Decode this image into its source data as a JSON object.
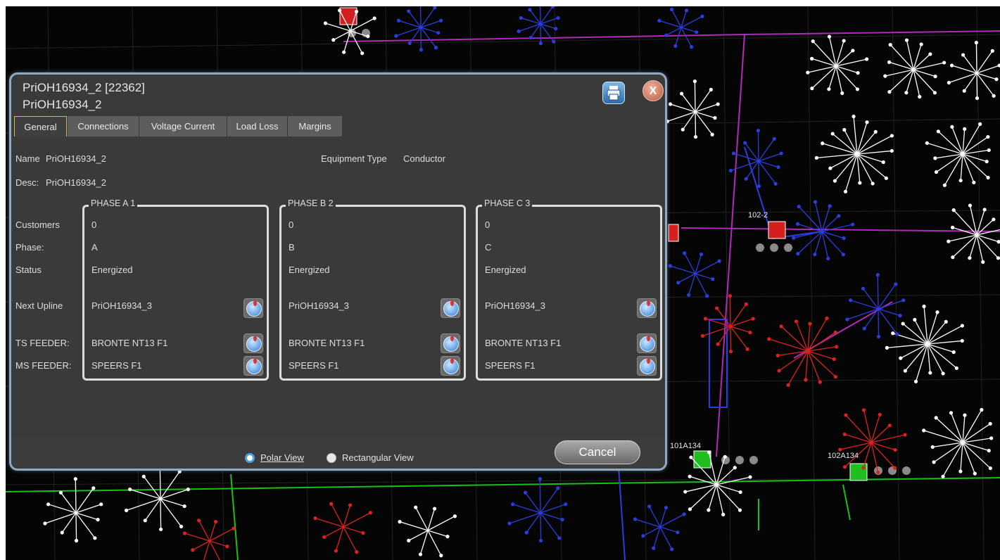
{
  "map": {
    "labels": [
      "102-2",
      "101A134",
      "102A134"
    ]
  },
  "dialog": {
    "title": "PriOH16934_2 [22362]",
    "subtitle": "PriOH16934_2",
    "print_icon": "printer-icon",
    "close_label": "X",
    "tabs": [
      "General",
      "Connections",
      "Voltage Current",
      "Load Loss",
      "Margins"
    ],
    "active_tab": "General",
    "name_label": "Name",
    "name_value": "PriOH16934_2",
    "equipment_type_label": "Equipment Type",
    "equipment_type_value": "Conductor",
    "desc_label": "Desc:",
    "desc_value": "PriOH16934_2",
    "row_labels": {
      "customers": "Customers",
      "phase": "Phase:",
      "status": "Status",
      "next_upline": "Next Upline",
      "ts_feeder": "TS FEEDER:",
      "ms_feeder": "MS FEEDER:"
    },
    "phases": [
      {
        "title": "PHASE A 1",
        "customers": "0",
        "phase": "A",
        "status": "Energized",
        "next_upline": "PriOH16934_3",
        "ts_feeder": "BRONTE NT13 F1",
        "ms_feeder": "SPEERS F1"
      },
      {
        "title": "PHASE B 2",
        "customers": "0",
        "phase": "B",
        "status": "Energized",
        "next_upline": "PriOH16934_3",
        "ts_feeder": "BRONTE NT13 F1",
        "ms_feeder": "SPEERS F1"
      },
      {
        "title": "PHASE C 3",
        "customers": "0",
        "phase": "C",
        "status": "Energized",
        "next_upline": "PriOH16934_3",
        "ts_feeder": "BRONTE NT13 F1",
        "ms_feeder": "SPEERS F1"
      }
    ],
    "locate_icon": "globe-locate-icon",
    "view_options": [
      {
        "label": "Polar View",
        "selected": true
      },
      {
        "label": "Rectangular View",
        "selected": false
      }
    ],
    "cancel_label": "Cancel"
  },
  "colors": {
    "map_bg": "#050505",
    "dialog_bg": "#3a3a3a",
    "dialog_border": "#8fa9c2",
    "active_tab_border": "#d6b84a",
    "radio_selected": "#4aa3df",
    "line_red": "#e02020",
    "line_blue": "#2a3ee0",
    "line_green": "#18c018",
    "line_magenta": "#b02ab8"
  }
}
